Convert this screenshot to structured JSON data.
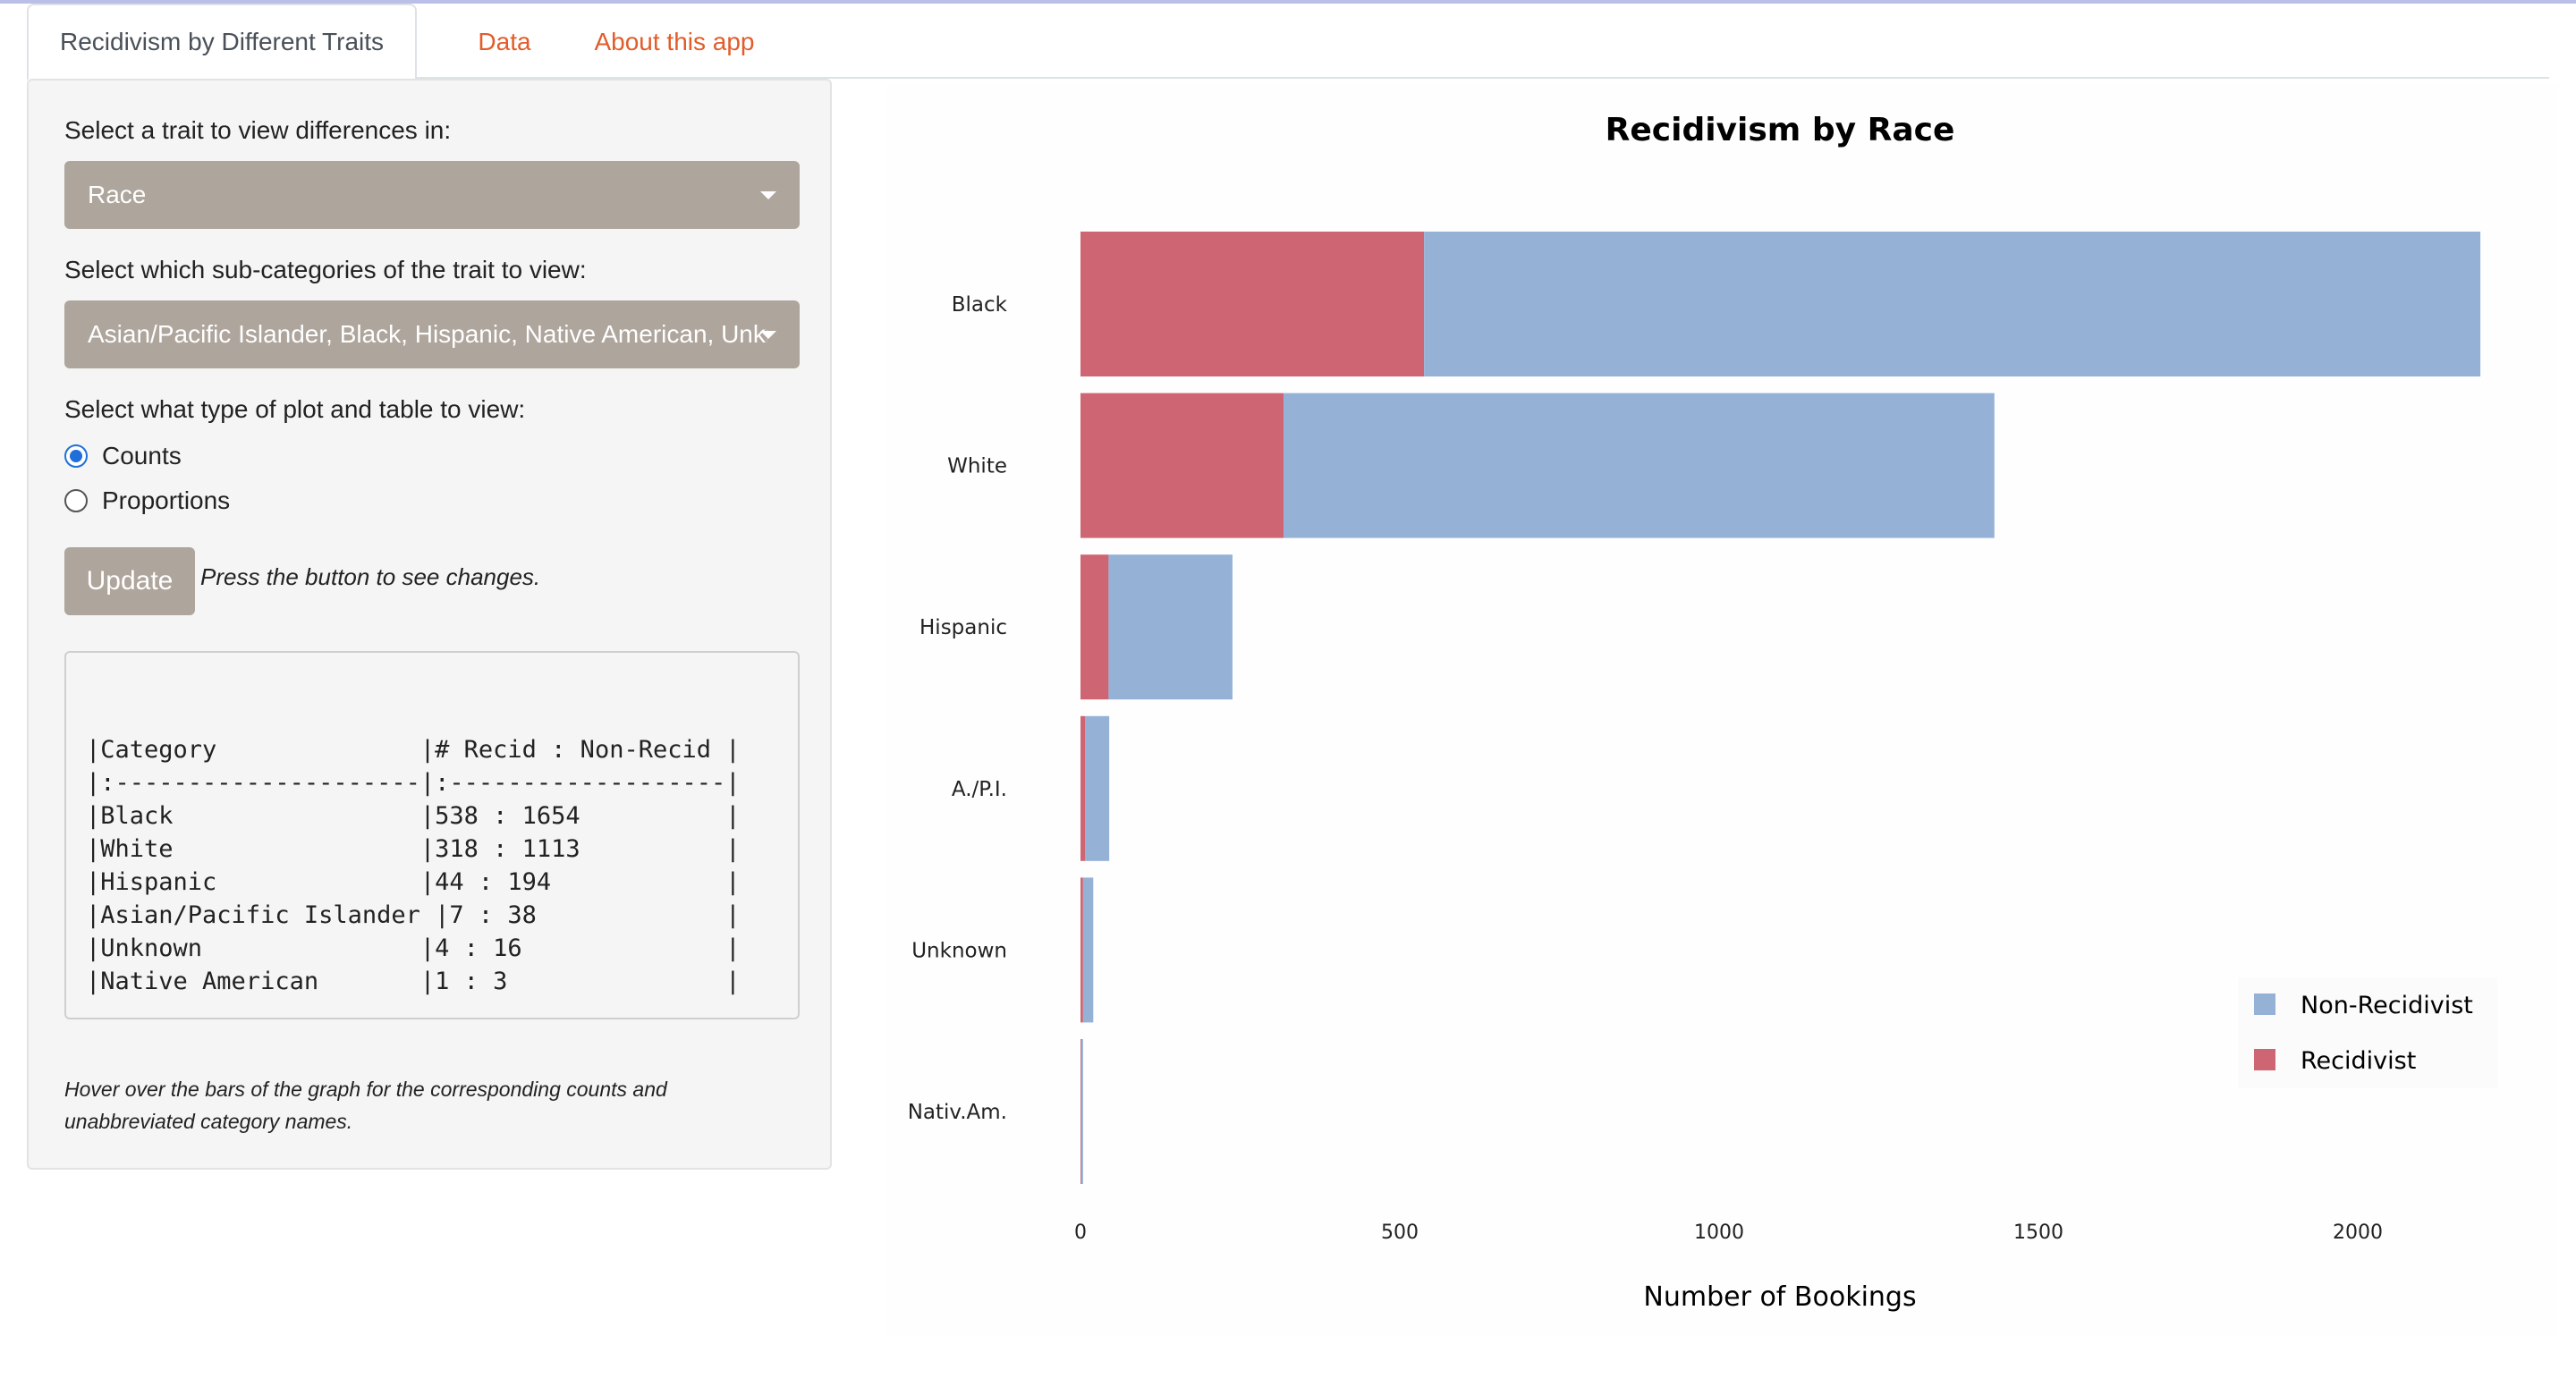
{
  "tabs": {
    "active": "Recidivism by Different Traits",
    "data": "Data",
    "about": "About this app"
  },
  "sidebar": {
    "trait_label": "Select a trait to view differences in:",
    "trait_value": "Race",
    "subcat_label": "Select which sub-categories of the trait to view:",
    "subcat_value": "Asian/Pacific Islander, Black, Hispanic, Native American, Unknown",
    "plot_type_label": "Select what type of plot and table to view:",
    "radio_counts": "Counts",
    "radio_proportions": "Proportions",
    "update_label": "Update",
    "update_hint": "Press the button to see changes.",
    "table_text": "|Category              |# Recid : Non-Recid |\n|:---------------------|:-------------------|\n|Black                 |538 : 1654          |\n|White                 |318 : 1113          |\n|Hispanic              |44 : 194            |\n|Asian/Pacific Islander |7 : 38             |\n|Unknown               |4 : 16              |\n|Native American       |1 : 3               |",
    "hover_note": "Hover over the bars of the graph for the corresponding counts and unabbreviated category names."
  },
  "colors": {
    "recidivist": "#cd6672",
    "non_recidivist": "#95b1d6"
  },
  "chart_data": {
    "type": "bar",
    "orientation": "horizontal",
    "stacked": true,
    "title": "Recidivism by Race",
    "xlabel": "Number of Bookings",
    "ylabel": "",
    "categories": [
      "Black",
      "White",
      "Hispanic",
      "A./P.I.",
      "Unknown",
      "Nativ.Am."
    ],
    "series": [
      {
        "name": "Recidivist",
        "values": [
          538,
          318,
          44,
          7,
          4,
          1
        ]
      },
      {
        "name": "Non-Recidivist",
        "values": [
          1654,
          1113,
          194,
          38,
          16,
          3
        ]
      }
    ],
    "xlim": [
      0,
      2200
    ],
    "xticks": [
      0,
      500,
      1000,
      1500,
      2000
    ],
    "legend": {
      "items": [
        "Non-Recidivist",
        "Recidivist"
      ],
      "position": "bottom-right"
    }
  }
}
